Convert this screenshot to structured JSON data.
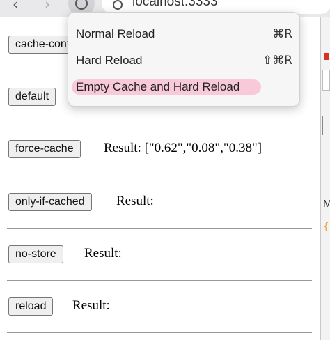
{
  "browser": {
    "url": "localhost:3333"
  },
  "menu": {
    "items": [
      {
        "label": "Normal Reload",
        "shortcut": "⌘R"
      },
      {
        "label": "Hard Reload",
        "shortcut": "⇧⌘R"
      },
      {
        "label": "Empty Cache and Hard Reload",
        "shortcut": ""
      }
    ],
    "highlight_color": "#f8c9d8"
  },
  "rows": [
    {
      "button": "cache-control",
      "result": ""
    },
    {
      "button": "default",
      "result": ""
    },
    {
      "button": "force-cache",
      "result": "Result:  [\"0.62\",\"0.08\",\"0.38\"]"
    },
    {
      "button": "only-if-cached",
      "result": "Result:"
    },
    {
      "button": "no-store",
      "result": "Result:"
    },
    {
      "button": "reload",
      "result": "Result:"
    }
  ],
  "devtools": {
    "letter": "M",
    "brace": "{"
  }
}
